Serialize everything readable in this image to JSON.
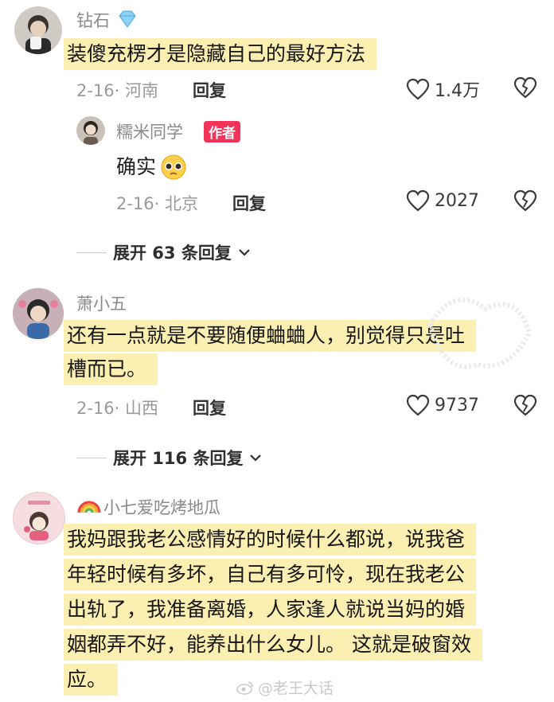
{
  "comments": [
    {
      "username": "钻石",
      "lines": [
        "装傻充楞才是隐藏自己的最好方法"
      ],
      "date_loc": "2-16· 河南",
      "reply_label": "回复",
      "likes": "1.4万",
      "replies": [
        {
          "username": "糯米同学",
          "badge": "作者",
          "lines": [
            "确实"
          ],
          "date_loc": "2-16· 北京",
          "reply_label": "回复",
          "likes": "2027"
        }
      ],
      "expand_label": "展开 63 条回复"
    },
    {
      "username": "萧小五",
      "lines": [
        "还有一点就是不要随便蛐蛐人，别觉得只是吐",
        "槽而已。"
      ],
      "date_loc": "2-16· 山西",
      "reply_label": "回复",
      "likes": "9737",
      "expand_label": "展开 116 条回复"
    },
    {
      "username": "小七爱吃烤地瓜",
      "lines": [
        "我妈跟我老公感情好的时候什么都说，说我爸",
        "年轻时候有多坏，自己有多可怜，现在我老公",
        "出轨了，我准备离婚，人家逢人就说当妈的婚",
        "姻都弄不好，能养出什么女儿。 这就是破窗效",
        "应。"
      ]
    }
  ],
  "watermark": "@老王大话",
  "colors": {
    "highlight": "#fbefb2",
    "badge": "#f2335a"
  }
}
